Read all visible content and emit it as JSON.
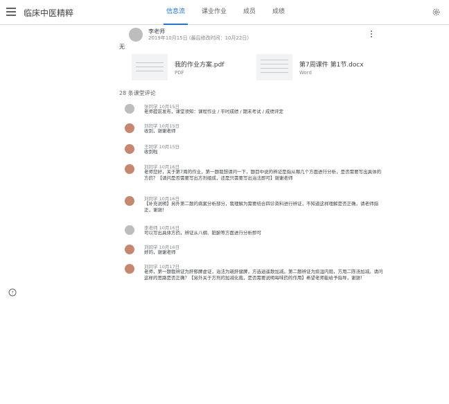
{
  "app": {
    "title": "临床中医精粹"
  },
  "tabs": [
    {
      "label": "信息流",
      "active": true
    },
    {
      "label": "课业作业",
      "active": false
    },
    {
      "label": "成员",
      "active": false
    },
    {
      "label": "成绩",
      "active": false
    }
  ],
  "post": {
    "author": "李老师",
    "time": "2019年10月15日 (最后修改时间：10月22日)",
    "text": "无",
    "attachments": [
      {
        "name": "我的作业方案.pdf",
        "type": "PDF"
      },
      {
        "name": "第7周课件 第1节.docx",
        "type": "Word"
      }
    ]
  },
  "comments_header": "28 条课堂评论",
  "comments": [
    {
      "author": "张同学",
      "time": "10月15日",
      "text": "老师提前发布，课堂须知：课程作业 / 平时成绩 / 期末考试 / 成绩评定",
      "avatar": "gray"
    },
    {
      "author": "刘同学",
      "time": "10月15日",
      "text": "收到，谢谢老师",
      "avatar": "brown"
    },
    {
      "author": "王同学",
      "time": "10月15日",
      "text": "收到啦",
      "avatar": "brown"
    },
    {
      "author": "刘同学",
      "time": "10月16日",
      "text": "老师您好，关于第7周的作业，第一题我想请问一下，题目中说的辨证是指从哪几个方面进行分析，是否需要写出具体的方药？【请问是否需要写出方剂组成，还是只需要写出治法即可】谢谢老师",
      "avatar": "brown"
    },
    {
      "author": "刘同学",
      "time": "10月16日",
      "text": "【补充说明】另外第二题的病案分析部分，我理解为需要结合四诊资料进行辨证，不知道这样理解是否正确，请老师指正，谢谢！",
      "avatar": "brown"
    },
    {
      "author": "李老师",
      "time": "10月16日",
      "text": "可以写出具体方药，辨证从八纲、脏腑等方面进行分析即可",
      "avatar": "gray"
    },
    {
      "author": "刘同学",
      "time": "10月16日",
      "text": "好的，谢谢老师",
      "avatar": "brown"
    },
    {
      "author": "刘同学",
      "time": "10月17日",
      "text": "老师，第一题我辨证为肝郁脾虚证，治法为疏肝健脾，方选逍遥散加减。第二题辨证为痰湿内阻，方用二陈汤加减。请问这样的思路是否正确？【另外关于方剂的加减化裁，是否需要说明每味药的作用】希望老师能给予指导，谢谢！",
      "avatar": "brown"
    }
  ]
}
